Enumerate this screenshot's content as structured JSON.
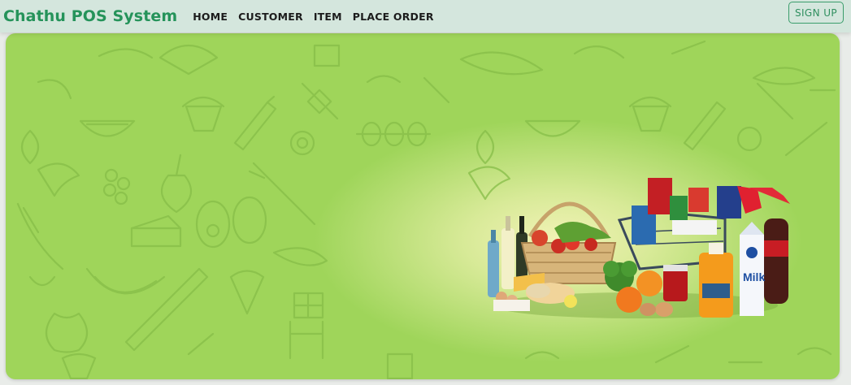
{
  "navbar": {
    "brand": "Chathu POS System",
    "links": [
      "HOME",
      "CUSTOMER",
      "ITEM",
      "PLACE ORDER"
    ],
    "signup_label": "SIGN UP"
  },
  "hero": {
    "background_color": "#9fd55a",
    "milk_label": "Milk",
    "illustration": "grocery-basket"
  },
  "colors": {
    "brand": "#25935a",
    "navbar_bg": "#d4e6dd",
    "hero_green": "#9fd55a"
  }
}
